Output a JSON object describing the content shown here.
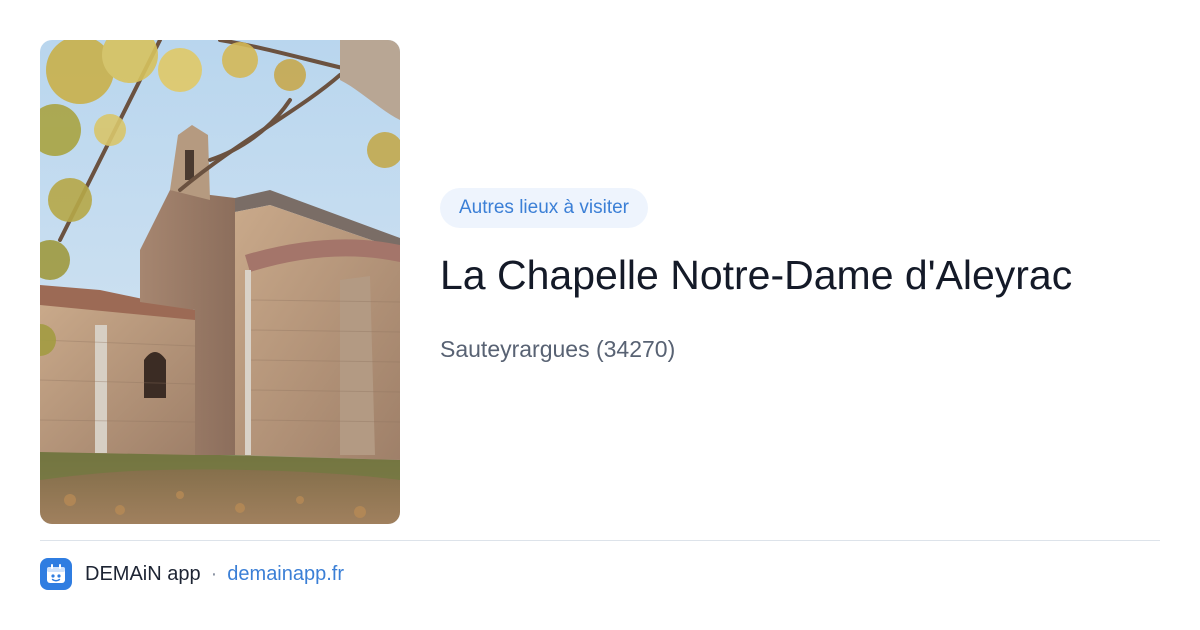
{
  "card": {
    "tag": "Autres lieux à visiter",
    "title": "La Chapelle Notre-Dame d'Aleyrac",
    "subtitle": "Sauteyrargues (34270)"
  },
  "photo": {
    "subject": "chapel-photo"
  },
  "footer": {
    "app_name": "DEMAiN app",
    "separator": "·",
    "link": "demainapp.fr",
    "icon": "demain-app-icon"
  },
  "colors": {
    "accent": "#3b7fd6",
    "tag_bg": "#eef4fd",
    "title": "#141a28",
    "subtitle": "#586273",
    "app_icon_bg": "#2f7de1"
  }
}
